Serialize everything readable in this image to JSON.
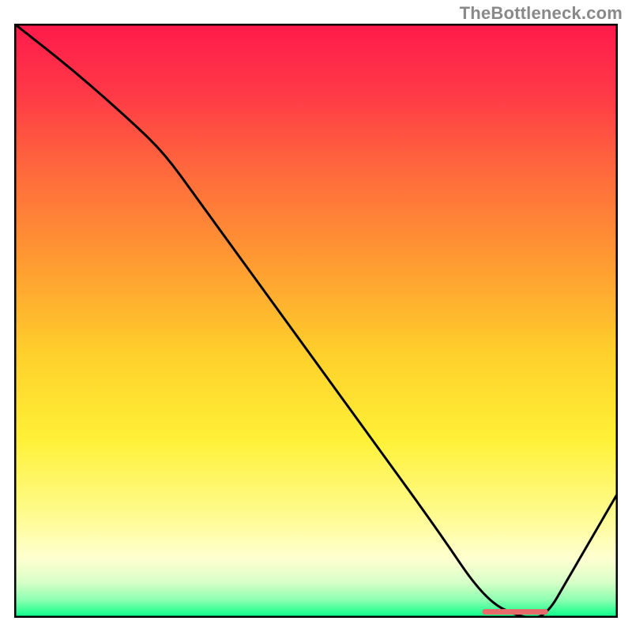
{
  "watermark": "TheBottleneck.com",
  "chart_data": {
    "type": "line",
    "title": "",
    "xlabel": "",
    "ylabel": "",
    "xlim": [
      0,
      100
    ],
    "ylim": [
      0,
      100
    ],
    "grid": false,
    "series": [
      {
        "name": "curve",
        "x": [
          0,
          10,
          20,
          25,
          30,
          40,
          50,
          60,
          70,
          78,
          84,
          88,
          92,
          96,
          100
        ],
        "y": [
          100,
          92,
          83,
          78,
          71,
          57,
          43,
          29,
          15,
          3,
          0,
          0,
          7,
          14,
          21
        ]
      }
    ],
    "marker": {
      "name": "highlight-segment",
      "x": [
        78,
        88
      ],
      "y": [
        1,
        1
      ],
      "color": "#e86b6b"
    },
    "gradient_stops": [
      {
        "offset": 0.0,
        "color": "#ff1a4b"
      },
      {
        "offset": 0.12,
        "color": "#ff3a47"
      },
      {
        "offset": 0.25,
        "color": "#ff6a3c"
      },
      {
        "offset": 0.4,
        "color": "#ff9a32"
      },
      {
        "offset": 0.55,
        "color": "#ffce2b"
      },
      {
        "offset": 0.7,
        "color": "#fff137"
      },
      {
        "offset": 0.82,
        "color": "#fffb8a"
      },
      {
        "offset": 0.9,
        "color": "#ffffd0"
      },
      {
        "offset": 0.94,
        "color": "#d8ffc8"
      },
      {
        "offset": 0.97,
        "color": "#8cffb0"
      },
      {
        "offset": 1.0,
        "color": "#00ff88"
      }
    ]
  }
}
